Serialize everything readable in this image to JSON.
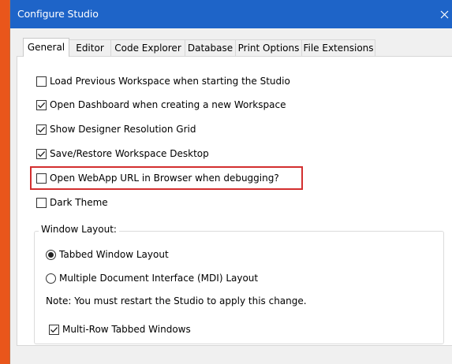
{
  "window": {
    "title": "Configure Studio",
    "close_glyph": "✕"
  },
  "tabs": [
    {
      "label": "General",
      "active": true
    },
    {
      "label": "Editor",
      "active": false
    },
    {
      "label": "Code Explorer",
      "active": false
    },
    {
      "label": "Database",
      "active": false
    },
    {
      "label": "Print Options",
      "active": false
    },
    {
      "label": "File Extensions",
      "active": false
    }
  ],
  "general": {
    "options": [
      {
        "label": "Load Previous Workspace when starting the Studio",
        "checked": false
      },
      {
        "label": "Open Dashboard when creating a new Workspace",
        "checked": true
      },
      {
        "label": "Show Designer Resolution Grid",
        "checked": true
      },
      {
        "label": "Save/Restore Workspace Desktop",
        "checked": true
      },
      {
        "label": "Open WebApp URL in Browser when debugging?",
        "checked": false,
        "highlighted": true
      },
      {
        "label": "Dark Theme",
        "checked": false
      }
    ],
    "window_layout": {
      "legend": "Window Layout:",
      "radios": [
        {
          "label": "Tabbed Window Layout",
          "selected": true
        },
        {
          "label": "Multiple Document Interface (MDI) Layout",
          "selected": false
        }
      ],
      "note": "Note: You must restart the Studio to apply this change.",
      "multi_row": {
        "label": "Multi-Row Tabbed Windows",
        "checked": true
      }
    }
  },
  "colors": {
    "titlebar": "#1e64c8",
    "highlight": "#d32f2f",
    "desktop": "#e9561b"
  }
}
